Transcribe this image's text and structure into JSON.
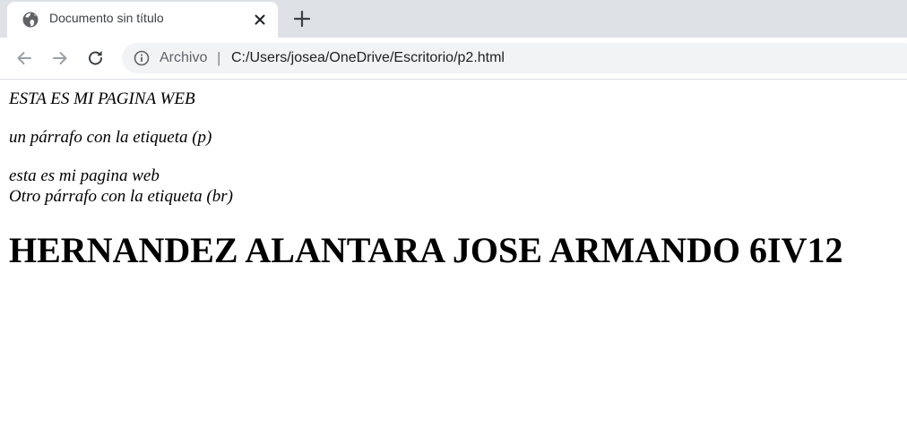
{
  "tab": {
    "title": "Documento sin título",
    "favicon": "globe-icon"
  },
  "toolbar": {
    "back_icon": "back-arrow-icon",
    "forward_icon": "forward-arrow-icon",
    "reload_icon": "reload-icon",
    "omnibox": {
      "info_icon": "info-icon",
      "scheme_label": "Archivo",
      "separator": "|",
      "url": "C:/Users/josea/OneDrive/Escritorio/p2.html"
    }
  },
  "page": {
    "line1": "ESTA ES MI PAGINA WEB",
    "line2": "un párrafo con la etiqueta (p)",
    "line3": "esta es mi pagina web",
    "line4": "Otro párrafo con la etiqueta (br)",
    "heading": "HERNANDEZ ALANTARA JOSE ARMANDO 6IV12"
  },
  "colors": {
    "tabstrip_bg": "#dee1e6",
    "omnibox_bg": "#f1f3f4",
    "icon_gray": "#5f6368",
    "disabled_gray": "#9aa0a6"
  }
}
